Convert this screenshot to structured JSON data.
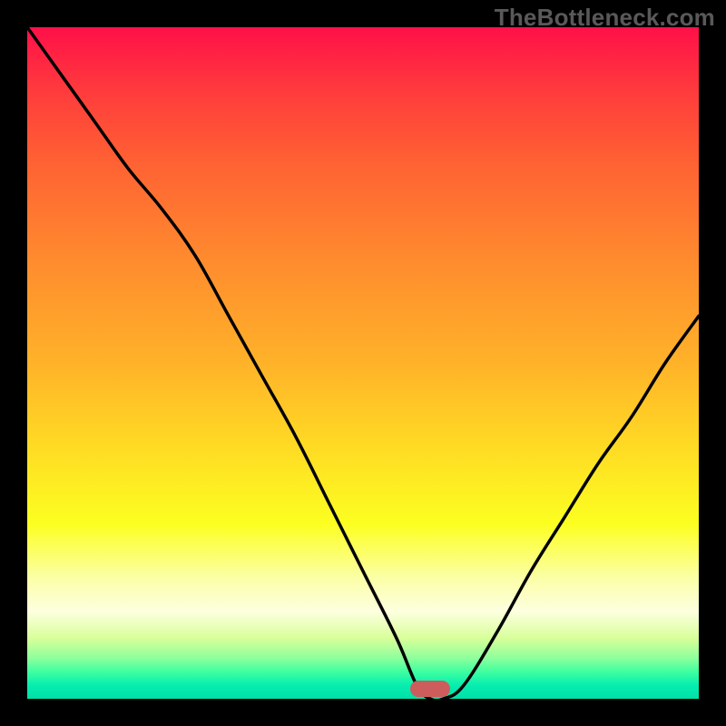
{
  "watermark": "TheBottleneck.com",
  "colors": {
    "background": "#000000",
    "curve": "#000000",
    "marker": "#cd5c5c",
    "gradient_top": "#ff1049",
    "gradient_bottom": "#00e0a8"
  },
  "chart_data": {
    "type": "line",
    "title": "",
    "xlabel": "",
    "ylabel": "",
    "xlim": [
      0,
      100
    ],
    "ylim": [
      0,
      100
    ],
    "grid": false,
    "legend": false,
    "annotations": [
      "TheBottleneck.com"
    ],
    "series": [
      {
        "name": "bottleneck-curve",
        "x": [
          0,
          5,
          10,
          15,
          20,
          25,
          30,
          35,
          40,
          45,
          50,
          55,
          58,
          60,
          62,
          65,
          70,
          75,
          80,
          85,
          90,
          95,
          100
        ],
        "y": [
          100,
          93,
          86,
          79,
          73,
          66,
          57,
          48,
          39,
          29,
          19,
          9,
          2,
          0,
          0,
          2,
          10,
          19,
          27,
          35,
          42,
          50,
          57
        ]
      }
    ],
    "optimal_marker": {
      "x_start": 57,
      "x_end": 63,
      "y": 0
    }
  }
}
